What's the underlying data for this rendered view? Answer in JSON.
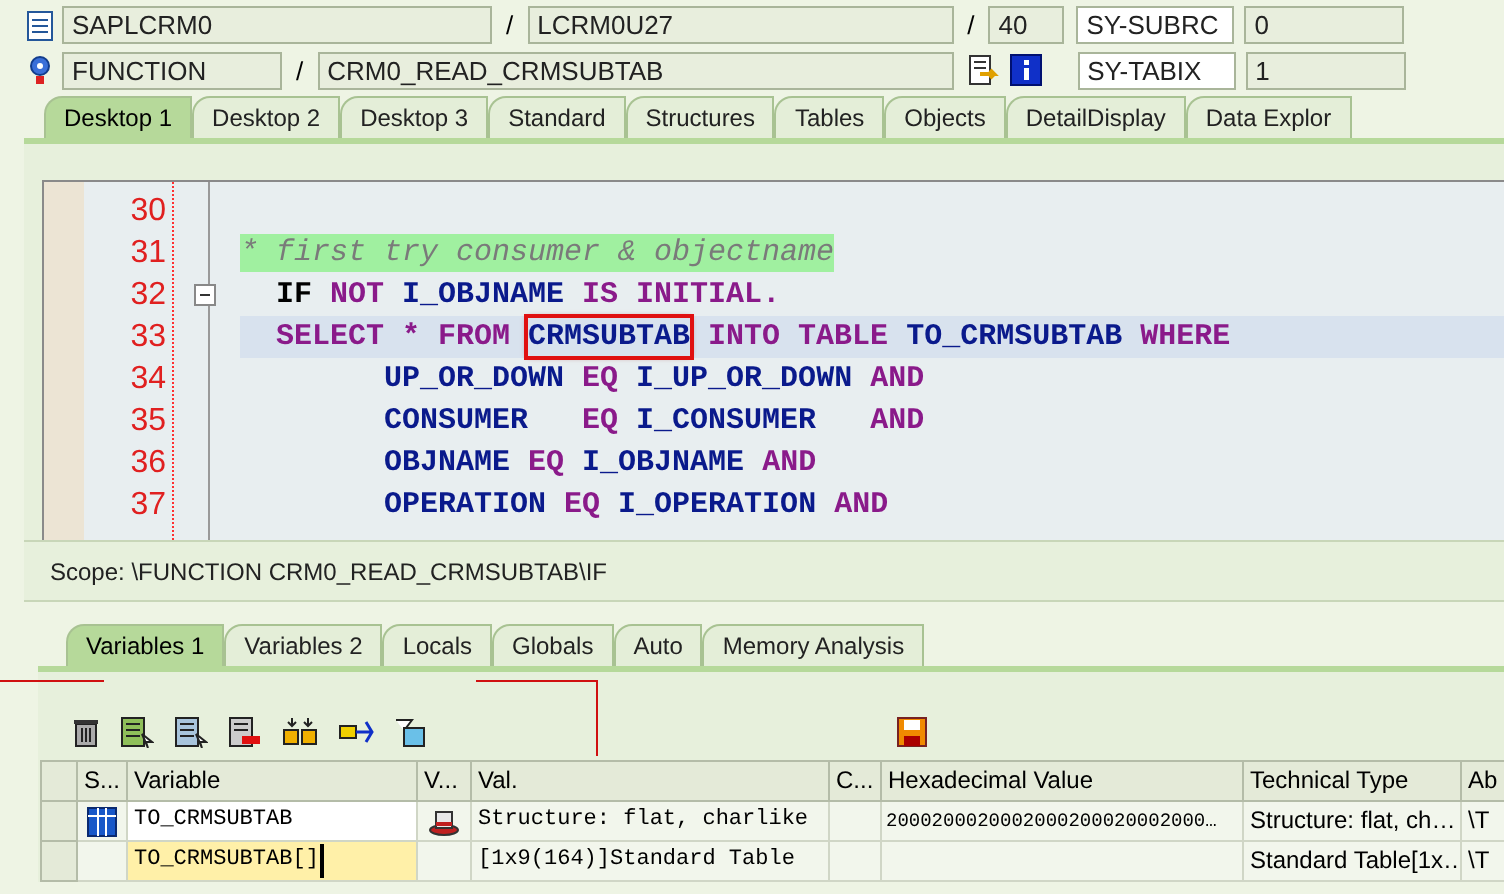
{
  "header": {
    "row1": {
      "program": "SAPLCRM0",
      "slash_1": "/",
      "include": "LCRM0U27",
      "slash_2": "/",
      "line": "40",
      "sys_field": "SY-SUBRC",
      "sys_value": "0"
    },
    "row2": {
      "type": "FUNCTION",
      "slash": "/",
      "name": "CRM0_READ_CRMSUBTAB",
      "sys_field": "SY-TABIX",
      "sys_value": "1"
    }
  },
  "desktop_tabs": [
    {
      "label": "Desktop 1",
      "selected": true
    },
    {
      "label": "Desktop 2",
      "selected": false
    },
    {
      "label": "Desktop 3",
      "selected": false
    },
    {
      "label": "Standard",
      "selected": false
    },
    {
      "label": "Structures",
      "selected": false
    },
    {
      "label": "Tables",
      "selected": false
    },
    {
      "label": "Objects",
      "selected": false
    },
    {
      "label": "DetailDisplay",
      "selected": false
    },
    {
      "label": "Data Explor",
      "selected": false
    }
  ],
  "code_lines": [
    {
      "number": "30",
      "highlighted": false,
      "fold": false
    },
    {
      "number": "31",
      "highlighted": false,
      "fold": false,
      "tokens": [
        {
          "text": "* first try consumer & objectname",
          "kind": "comment"
        }
      ]
    },
    {
      "number": "32",
      "highlighted": false,
      "fold": true,
      "tokens": [
        {
          "text": "  IF",
          "kind": "plain"
        },
        {
          "text": " NOT",
          "kind": "keyword"
        },
        {
          "text": " I_OBJNAME",
          "kind": "ident"
        },
        {
          "text": " IS INITIAL.",
          "kind": "keyword"
        }
      ]
    },
    {
      "number": "33",
      "highlighted": true,
      "fold": false,
      "tokens": [
        {
          "text": "  SELECT * FROM ",
          "kind": "keyword"
        },
        {
          "text": "CRMSUBTAB",
          "kind": "ident",
          "boxed": true
        },
        {
          "text": " INTO TABLE",
          "kind": "keyword"
        },
        {
          "text": " TO_CRMSUBTAB",
          "kind": "ident"
        },
        {
          "text": " WHERE",
          "kind": "keyword"
        }
      ]
    },
    {
      "number": "34",
      "highlighted": false,
      "fold": false,
      "tokens": [
        {
          "text": "        UP_OR_DOWN",
          "kind": "ident"
        },
        {
          "text": " EQ",
          "kind": "keyword"
        },
        {
          "text": " I_UP_OR_DOWN",
          "kind": "ident"
        },
        {
          "text": " AND",
          "kind": "keyword"
        }
      ]
    },
    {
      "number": "35",
      "highlighted": false,
      "fold": false,
      "tokens": [
        {
          "text": "        CONSUMER",
          "kind": "ident"
        },
        {
          "text": "   EQ",
          "kind": "keyword"
        },
        {
          "text": " I_CONSUMER",
          "kind": "ident"
        },
        {
          "text": "   AND",
          "kind": "keyword"
        }
      ]
    },
    {
      "number": "36",
      "highlighted": false,
      "fold": false,
      "tokens": [
        {
          "text": "        OBJNAME",
          "kind": "ident"
        },
        {
          "text": " EQ",
          "kind": "keyword"
        },
        {
          "text": " I_OBJNAME",
          "kind": "ident"
        },
        {
          "text": " AND",
          "kind": "keyword"
        }
      ]
    },
    {
      "number": "37",
      "highlighted": false,
      "fold": false,
      "tokens": [
        {
          "text": "        OPERATION",
          "kind": "ident"
        },
        {
          "text": " EQ",
          "kind": "keyword"
        },
        {
          "text": " I_OPERATION",
          "kind": "ident"
        },
        {
          "text": " AND",
          "kind": "keyword"
        }
      ]
    }
  ],
  "scope": "Scope: \\FUNCTION CRM0_READ_CRMSUBTAB\\IF",
  "variable_tabs": [
    {
      "label": "Variables 1",
      "selected": true
    },
    {
      "label": "Variables 2",
      "selected": false
    },
    {
      "label": "Locals",
      "selected": false
    },
    {
      "label": "Globals",
      "selected": false
    },
    {
      "label": "Auto",
      "selected": false
    },
    {
      "label": "Memory Analysis",
      "selected": false
    }
  ],
  "table": {
    "columns": [
      "S...",
      "Variable",
      "V...",
      "Val.",
      "C...",
      "Hexadecimal Value",
      "Technical Type",
      "Ab"
    ],
    "rows": [
      {
        "kind": "table",
        "editing": false,
        "variable": "TO_CRMSUBTAB",
        "value": "Structure: flat, charlike",
        "hex": "2000200020002000200020002000…",
        "technical_type": "Structure: flat, ch…",
        "abs": "\\T"
      },
      {
        "kind": "plain",
        "editing": true,
        "variable": "TO_CRMSUBTAB[]",
        "value": "[1x9(164)]Standard Table",
        "hex": "",
        "technical_type": "Standard Table[1x…",
        "abs": "\\T"
      }
    ]
  }
}
